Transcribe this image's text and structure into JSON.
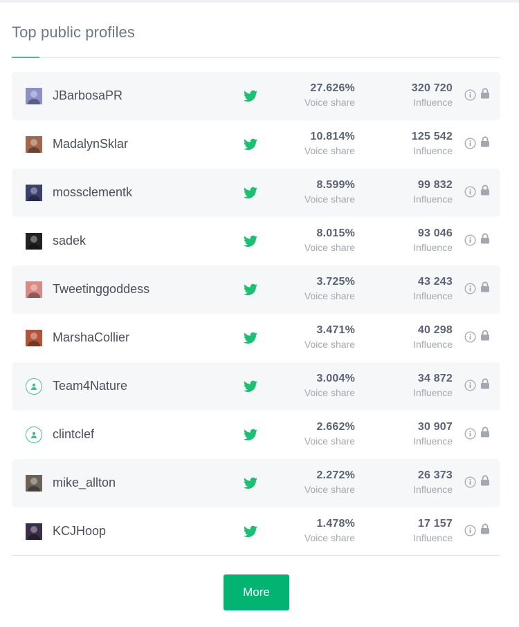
{
  "title": "Top public profiles",
  "colors": {
    "accent": "#03b372",
    "twitter": "#1dbf73"
  },
  "profiles": [
    {
      "name": "JBarbosaPR",
      "avatar": "photo",
      "avatar_color": "#8d8fc9",
      "network": "twitter",
      "voice_share": "27.626%",
      "voice_share_label": "Voice share",
      "influence": "320 720",
      "influence_label": "Influence"
    },
    {
      "name": "MadalynSklar",
      "avatar": "photo",
      "avatar_color": "#a0674a",
      "network": "twitter",
      "voice_share": "10.814%",
      "voice_share_label": "Voice share",
      "influence": "125 542",
      "influence_label": "Influence"
    },
    {
      "name": "mossclementk",
      "avatar": "photo",
      "avatar_color": "#3a3f6e",
      "network": "twitter",
      "voice_share": "8.599%",
      "voice_share_label": "Voice share",
      "influence": "99 832",
      "influence_label": "Influence"
    },
    {
      "name": "sadek",
      "avatar": "photo",
      "avatar_color": "#222222",
      "network": "twitter",
      "voice_share": "8.015%",
      "voice_share_label": "Voice share",
      "influence": "93 046",
      "influence_label": "Influence"
    },
    {
      "name": "Tweetinggoddess",
      "avatar": "photo",
      "avatar_color": "#d98a84",
      "network": "twitter",
      "voice_share": "3.725%",
      "voice_share_label": "Voice share",
      "influence": "43 243",
      "influence_label": "Influence"
    },
    {
      "name": "MarshaCollier",
      "avatar": "photo",
      "avatar_color": "#b5533a",
      "network": "twitter",
      "voice_share": "3.471%",
      "voice_share_label": "Voice share",
      "influence": "40 298",
      "influence_label": "Influence"
    },
    {
      "name": "Team4Nature",
      "avatar": "placeholder",
      "avatar_color": "#3ec28f",
      "network": "twitter",
      "voice_share": "3.004%",
      "voice_share_label": "Voice share",
      "influence": "34 872",
      "influence_label": "Influence"
    },
    {
      "name": "clintclef",
      "avatar": "placeholder",
      "avatar_color": "#3ec28f",
      "network": "twitter",
      "voice_share": "2.662%",
      "voice_share_label": "Voice share",
      "influence": "30 907",
      "influence_label": "Influence"
    },
    {
      "name": "mike_allton",
      "avatar": "photo",
      "avatar_color": "#6b6258",
      "network": "twitter",
      "voice_share": "2.272%",
      "voice_share_label": "Voice share",
      "influence": "26 373",
      "influence_label": "Influence"
    },
    {
      "name": "KCJHoop",
      "avatar": "photo",
      "avatar_color": "#3b2e4a",
      "network": "twitter",
      "voice_share": "1.478%",
      "voice_share_label": "Voice share",
      "influence": "17 157",
      "influence_label": "Influence"
    }
  ],
  "more_button": "More"
}
